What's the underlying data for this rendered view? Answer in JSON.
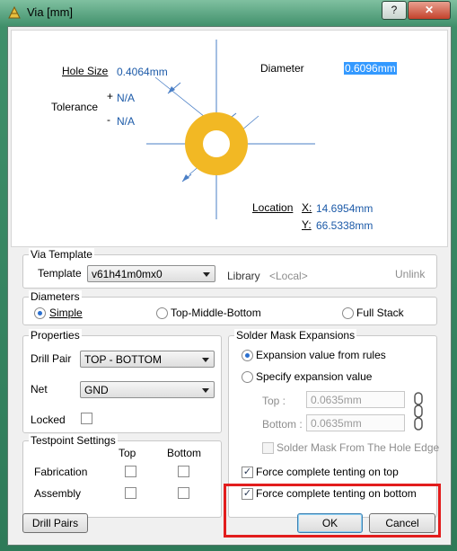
{
  "window": {
    "title": "Via [mm]",
    "help_glyph": "?",
    "close_glyph": "✕"
  },
  "diagram": {
    "hole_size_label": "Hole Size",
    "hole_size_value": "0.4064mm",
    "tolerance_label": "Tolerance",
    "tol_plus_sign": "+",
    "tol_plus_value": "N/A",
    "tol_minus_sign": "-",
    "tol_minus_value": "N/A",
    "diameter_label": "Diameter",
    "diameter_value": "0.6096mm",
    "location_label": "Location",
    "x_label": "X:",
    "x_value": "14.6954mm",
    "y_label": "Y:",
    "y_value": "66.5338mm",
    "pad_color": "#f2b824"
  },
  "via_template": {
    "group_title": "Via Template",
    "template_label": "Template",
    "template_value": "v61h41m0mx0",
    "library_label": "Library",
    "library_value": "<Local>",
    "unlink_label": "Unlink"
  },
  "diameters": {
    "group_title": "Diameters",
    "options": [
      "Simple",
      "Top-Middle-Bottom",
      "Full Stack"
    ],
    "selected": "Simple"
  },
  "properties": {
    "group_title": "Properties",
    "drill_pair_label": "Drill Pair",
    "drill_pair_value": "TOP - BOTTOM",
    "net_label": "Net",
    "net_value": "GND",
    "locked_label": "Locked",
    "locked": false
  },
  "testpoint": {
    "group_title": "Testpoint Settings",
    "col_top": "Top",
    "col_bottom": "Bottom",
    "row_fabrication": "Fabrication",
    "row_assembly": "Assembly"
  },
  "solder_mask": {
    "group_title": "Solder Mask Expansions",
    "opt_rules": "Expansion value from rules",
    "opt_specify": "Specify expansion value",
    "top_label": "Top :",
    "top_value": "0.0635mm",
    "bottom_label": "Bottom :",
    "bottom_value": "0.0635mm",
    "from_hole_edge_label": "Solder Mask From The Hole Edge",
    "tenting_top_label": "Force complete tenting on top",
    "tenting_top": true,
    "tenting_bottom_label": "Force complete tenting on bottom",
    "tenting_bottom": true,
    "highlight_color": "#e21d1d"
  },
  "buttons": {
    "drill_pairs": "Drill Pairs",
    "ok": "OK",
    "cancel": "Cancel"
  }
}
